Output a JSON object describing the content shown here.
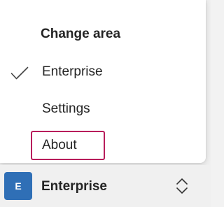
{
  "popup": {
    "title": "Change area",
    "items": [
      {
        "label": "Enterprise",
        "selected": true,
        "icon": "checkmark-icon"
      },
      {
        "label": "Settings",
        "selected": false
      },
      {
        "label": "About",
        "selected": false,
        "focused": true
      }
    ]
  },
  "switcher": {
    "avatar_letter": "E",
    "label": "Enterprise",
    "icon": "chevron-up-down-icon"
  },
  "colors": {
    "focus_ring": "#b81d5b",
    "avatar_bg": "#2f6fb6",
    "text": "#242424"
  }
}
